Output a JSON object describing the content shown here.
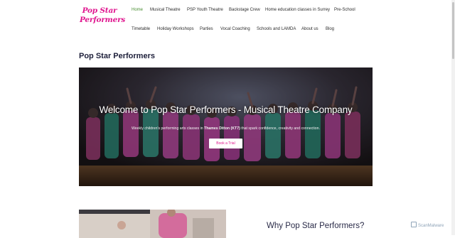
{
  "logo": {
    "line1": "Pop Star",
    "line2": "Performers"
  },
  "nav": {
    "items": [
      {
        "label": "Home",
        "active": true
      },
      {
        "label": "Musical Theatre"
      },
      {
        "label": "PSP Youth Theatre"
      },
      {
        "label": "Backstage Crew"
      },
      {
        "label": "Home education classes in Surrey"
      },
      {
        "label": "Pre-School"
      },
      {
        "label": "Timetable"
      },
      {
        "label": "Holiday Workshops"
      },
      {
        "label": "Parties"
      },
      {
        "label": "Vocal Coaching"
      },
      {
        "label": "Schools and LAMDA"
      },
      {
        "label": "About us"
      },
      {
        "label": "Blog"
      }
    ]
  },
  "page": {
    "title": "Pop Star Performers"
  },
  "hero": {
    "title": "Welcome to Pop Star Performers - Musical Theatre Company",
    "subtitle_before": "Weekly children's performing arts classes in ",
    "subtitle_bold": "Thames Ditton (KT7)",
    "subtitle_after": " that spark confidence, creativity and connection.",
    "button": "Book a Trial"
  },
  "section2": {
    "heading": "Why Pop Star Performers?"
  },
  "badge": {
    "label": "ScanMalware"
  },
  "colors": {
    "brand_pink": "#e0168f",
    "nav_active": "#4a8e33",
    "heading": "#1d1f3a"
  }
}
